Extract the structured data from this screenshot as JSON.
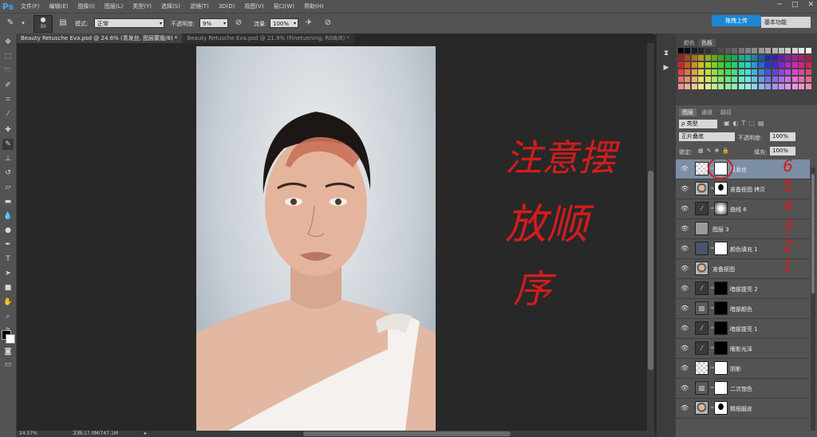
{
  "menubar": {
    "logo": "Ps",
    "items": [
      "文件(F)",
      "编辑(E)",
      "图像(I)",
      "图层(L)",
      "类型(Y)",
      "选择(S)",
      "滤镜(T)",
      "3D(D)",
      "视图(V)",
      "窗口(W)",
      "帮助(H)"
    ],
    "win_controls": [
      "─",
      "□",
      "✕"
    ]
  },
  "options": {
    "brush_size": "30",
    "mode_label": "模式:",
    "mode_value": "正常",
    "opacity_label": "不透明度:",
    "opacity_value": "9%",
    "flow_label": "流量:",
    "flow_value": "100%",
    "upload_button": "拖拽上传",
    "workspace": "基本功能"
  },
  "tabs": [
    {
      "label": "Beauty Retusche Eva.psd @ 24.6% (青发丝, 图层蒙版/8) *",
      "active": true
    },
    {
      "label": "Beauty Retusche Eva.psd @ 21.9% (Finetuening, RGB/8) *",
      "active": false
    }
  ],
  "status": {
    "zoom": "24.57%",
    "doc_size": "文档:17.0M/747.1M"
  },
  "panels": {
    "swatch_tabs": [
      "颜色",
      "色板"
    ],
    "layer_tabs": [
      "图层",
      "通道",
      "路径"
    ],
    "kind_filter": "ρ 类型",
    "blend_mode": "正片叠底",
    "opacity_label": "不透明度:",
    "opacity_value": "100%",
    "lock_label": "锁定:",
    "fill_label": "填充:",
    "fill_value": "100%"
  },
  "layers": [
    {
      "name": "青发丝",
      "thumb": "checker",
      "mask": "white",
      "selected": true
    },
    {
      "name": "准备抠图 拷贝",
      "thumb": "face",
      "mask": "silhouette",
      "selected": false
    },
    {
      "name": "曲线 6",
      "thumb": "adjust",
      "mask": "gradient",
      "selected": false
    },
    {
      "name": "图层 3",
      "thumb": "gray",
      "mask": "",
      "selected": false
    },
    {
      "name": "颜色填充 1",
      "thumb": "darkblue",
      "mask": "white",
      "selected": false
    },
    {
      "name": "准备抠图",
      "thumb": "face",
      "mask": "",
      "selected": false
    },
    {
      "name": "暗部提亮 2",
      "thumb": "adjust",
      "mask": "black",
      "selected": false
    },
    {
      "name": "暗部颜色",
      "thumb": "adjust2",
      "mask": "black",
      "selected": false
    },
    {
      "name": "暗部提亮 1",
      "thumb": "adjust",
      "mask": "black",
      "selected": false
    },
    {
      "name": "眼影光泽",
      "thumb": "adjust",
      "mask": "black",
      "selected": false
    },
    {
      "name": "阴影",
      "thumb": "checker",
      "mask": "white",
      "selected": false
    },
    {
      "name": "二次饱色",
      "thumb": "adjust2",
      "mask": "white",
      "selected": false
    },
    {
      "name": "精细磨皮",
      "thumb": "face",
      "mask": "silhouette",
      "selected": false
    }
  ],
  "annotations": {
    "text_lines": [
      "注意摆",
      "放顺",
      "序"
    ],
    "numbers": [
      "6",
      "5",
      "4",
      "3",
      "2",
      "1"
    ],
    "ink_color": "#d41c1c"
  }
}
